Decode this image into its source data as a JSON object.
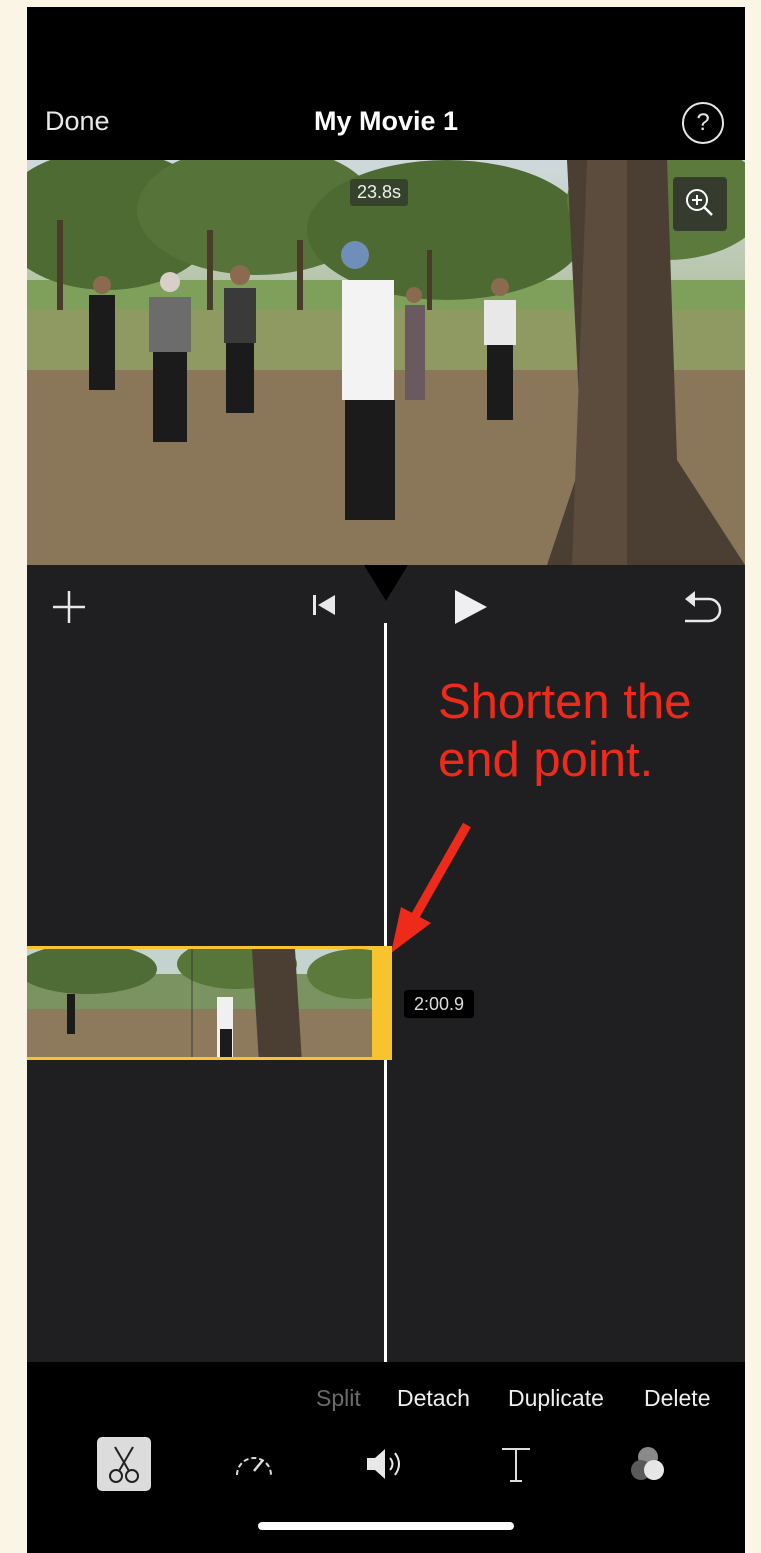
{
  "header": {
    "done_label": "Done",
    "title": "My Movie 1",
    "help_label": "?"
  },
  "viewer": {
    "duration_label": "23.8s"
  },
  "timeline": {
    "clip_time": "2:00.9",
    "annotation_line1": "Shorten the",
    "annotation_line2": "end point."
  },
  "actions": {
    "split": "Split",
    "detach": "Detach",
    "duplicate": "Duplicate",
    "delete": "Delete"
  },
  "tabs": [
    {
      "icon": "scissors-icon"
    },
    {
      "icon": "speedometer-icon"
    },
    {
      "icon": "speaker-icon"
    },
    {
      "icon": "text-icon"
    },
    {
      "icon": "filters-icon"
    }
  ],
  "colors": {
    "accent": "#f7c32e",
    "annotation": "#ee2b1b",
    "editor_bg": "#1f1f21"
  }
}
